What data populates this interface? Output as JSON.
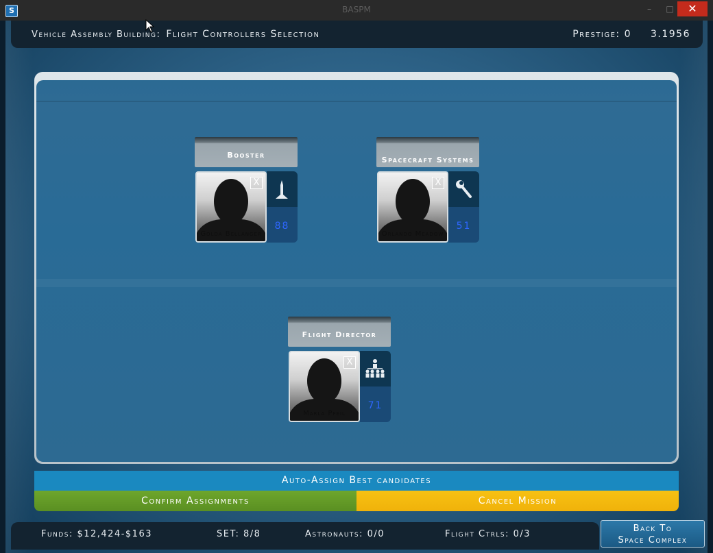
{
  "window": {
    "title": "BASPM",
    "close_glyph": "✕",
    "min_glyph": "–",
    "max_glyph": "□"
  },
  "header": {
    "location": "Vehicle Assembly Building:",
    "screen": "Flight Controllers Selection",
    "prestige": "Prestige: 0",
    "date": "3.1956"
  },
  "slots": [
    {
      "role": "Booster",
      "name": "Golda Bellanger",
      "skill": "88",
      "icon": "rocket-icon"
    },
    {
      "role": "Spacecraft Systems",
      "name": "Orlando Meadow",
      "skill": "51",
      "icon": "wrench-icon"
    },
    {
      "role": "Flight Director",
      "name": "Marla Pfeil",
      "skill": "71",
      "icon": "team-icon"
    }
  ],
  "remove_glyph": "X",
  "buttons": {
    "auto_assign": "Auto-Assign Best candidates",
    "confirm": "Confirm Assignments",
    "cancel": "Cancel Mission",
    "back_line1": "Back To",
    "back_line2": "Space Complex"
  },
  "status": {
    "funds": "Funds: $12,424-$163",
    "set": "SET: 8/8",
    "astronauts": "Astronauts: 0/0",
    "flight_ctrls": "Flight Ctrls: 0/3"
  },
  "colors": {
    "confirm": "#6ea62c",
    "cancel": "#f7c113",
    "auto": "#1a89c0",
    "skill_value": "#2e67ff"
  }
}
